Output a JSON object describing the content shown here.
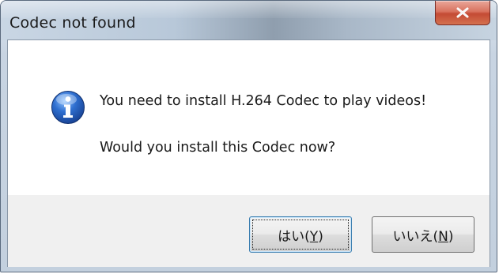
{
  "window": {
    "title": "Codec not found",
    "close_label": "×"
  },
  "message": {
    "icon": "info-icon",
    "line1": "You need to install H.264 Codec to play videos!",
    "line2": "Would you install this Codec now?"
  },
  "buttons": {
    "yes": {
      "prefix": "はい(",
      "accel": "Y",
      "suffix": ")"
    },
    "no": {
      "prefix": "いいえ(",
      "accel": "N",
      "suffix": ")"
    }
  },
  "colors": {
    "close_button": "#c44b34",
    "info_icon": "#1f56b0",
    "default_button_border": "#3c7fb1"
  }
}
